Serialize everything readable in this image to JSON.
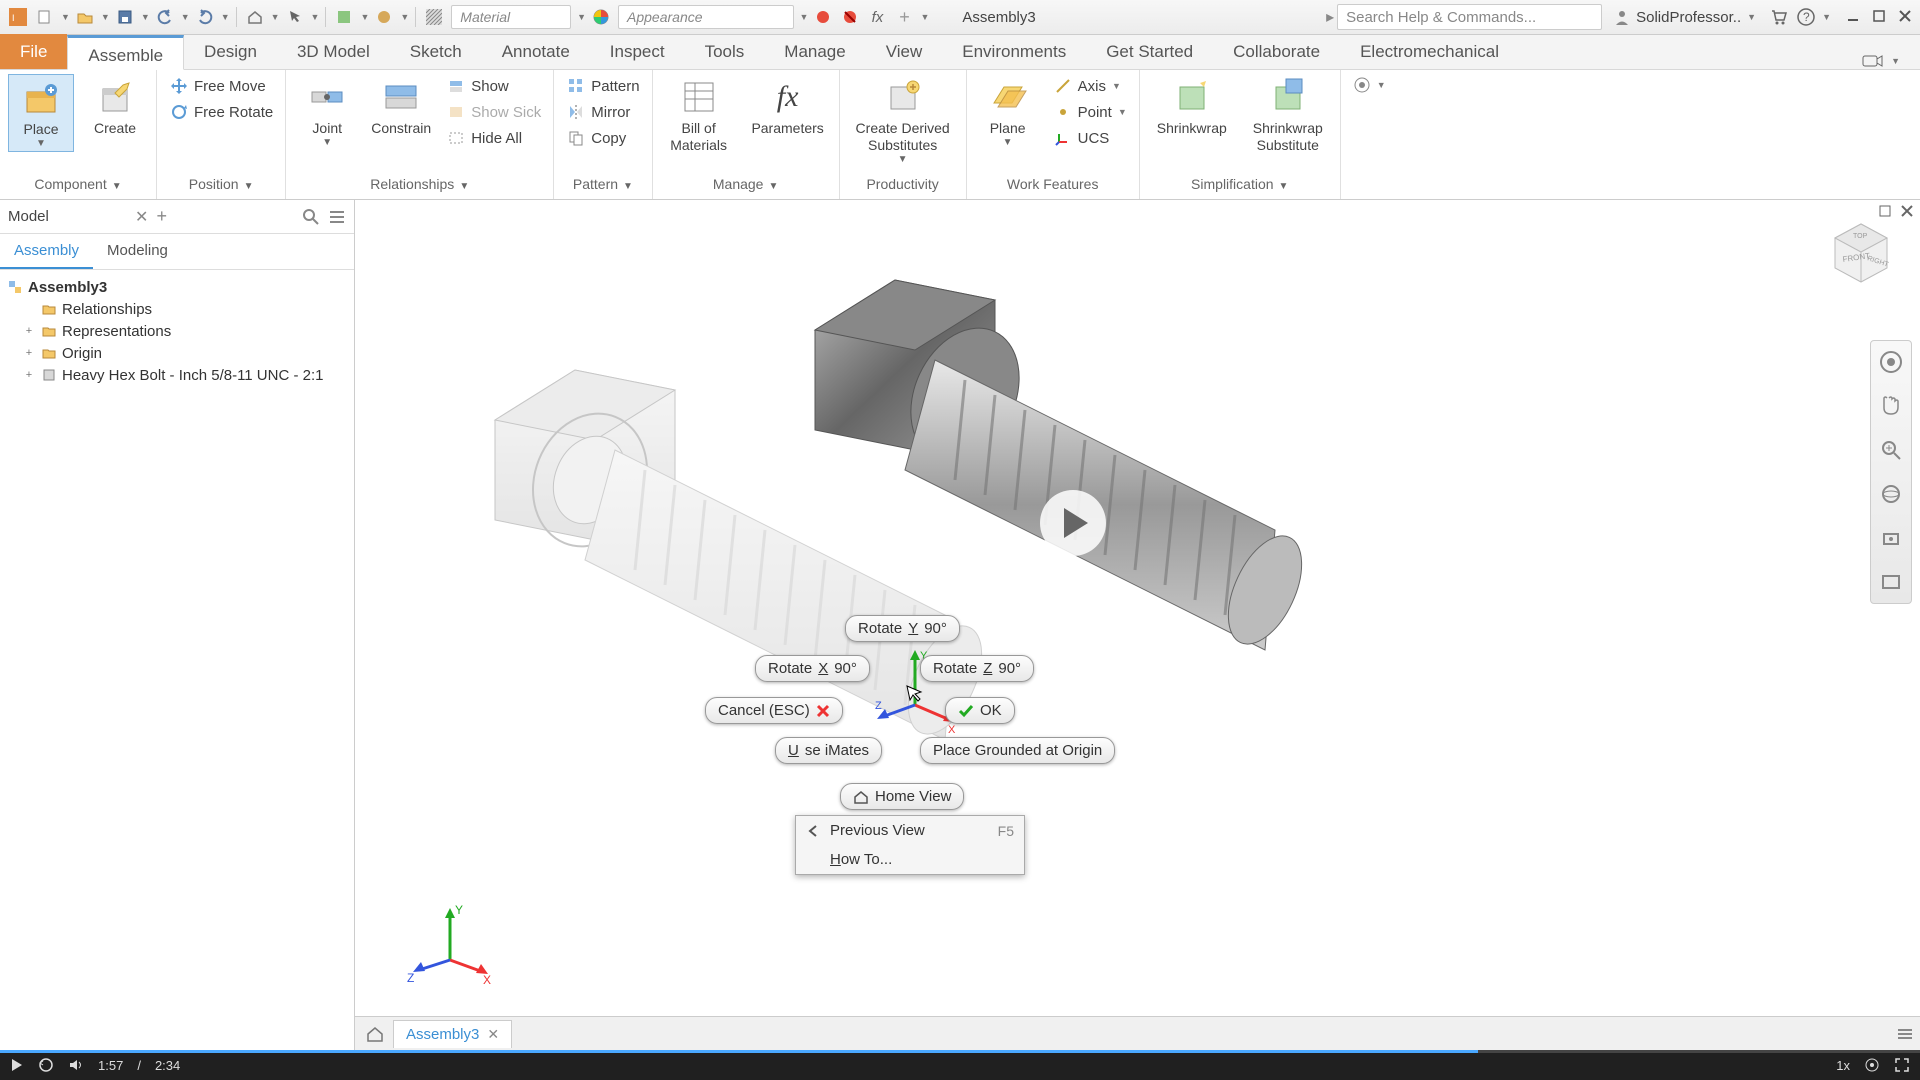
{
  "qat": {
    "material_placeholder": "Material",
    "appearance_placeholder": "Appearance",
    "doc_title": "Assembly3",
    "search_placeholder": "Search Help & Commands...",
    "user": "SolidProfessor.."
  },
  "tabs": {
    "file": "File",
    "list": [
      "Assemble",
      "Design",
      "3D Model",
      "Sketch",
      "Annotate",
      "Inspect",
      "Tools",
      "Manage",
      "View",
      "Environments",
      "Get Started",
      "Collaborate",
      "Electromechanical"
    ],
    "active_index": 0
  },
  "ribbon": {
    "component": {
      "place": "Place",
      "create": "Create",
      "title": "Component"
    },
    "position": {
      "free_move": "Free Move",
      "free_rotate": "Free Rotate",
      "title": "Position"
    },
    "relationships": {
      "joint": "Joint",
      "constrain": "Constrain",
      "show": "Show",
      "show_sick": "Show Sick",
      "hide_all": "Hide All",
      "title": "Relationships"
    },
    "pattern": {
      "pattern": "Pattern",
      "mirror": "Mirror",
      "copy": "Copy",
      "title": "Pattern"
    },
    "manage": {
      "bom": "Bill of\nMaterials",
      "params": "Parameters",
      "title": "Manage"
    },
    "productivity": {
      "derived": "Create Derived\nSubstitutes",
      "title": "Productivity"
    },
    "workfeat": {
      "plane": "Plane",
      "axis": "Axis",
      "point": "Point",
      "ucs": "UCS",
      "title": "Work Features"
    },
    "simplification": {
      "shrink": "Shrinkwrap",
      "shrink_sub": "Shrinkwrap\nSubstitute",
      "title": "Simplification"
    }
  },
  "browser": {
    "title": "Model",
    "tabs": {
      "assembly": "Assembly",
      "modeling": "Modeling"
    },
    "root": "Assembly3",
    "nodes": [
      "Relationships",
      "Representations",
      "Origin",
      "Heavy Hex Bolt - Inch 5/8-11 UNC - 2:1"
    ]
  },
  "context": {
    "rotate_y": "Rotate Y 90°",
    "rotate_x": "Rotate X 90°",
    "rotate_z": "Rotate Z 90°",
    "cancel": "Cancel (ESC)",
    "ok": "OK",
    "imates": "Use iMates",
    "ground": "Place Grounded at Origin",
    "home": "Home View",
    "prev": "Previous View",
    "prev_key": "F5",
    "howto": "How To..."
  },
  "axes": {
    "x": "X",
    "y": "Y",
    "z": "Z"
  },
  "doc_tab": "Assembly3",
  "player": {
    "current": "1:57",
    "sep": "/",
    "total": "2:34",
    "speed": "1x",
    "progress_pct": 77
  }
}
